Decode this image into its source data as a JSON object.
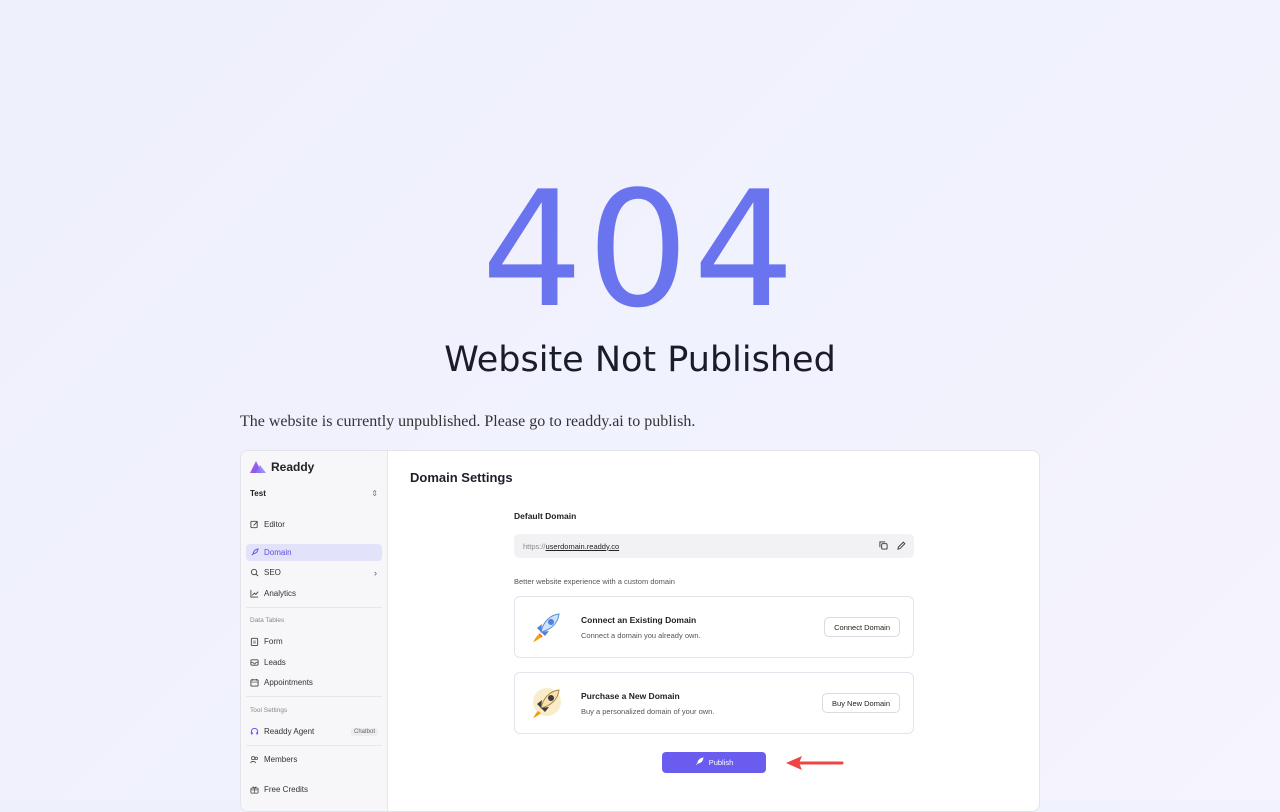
{
  "error": {
    "code": "404",
    "title": "Website Not Published",
    "message": "The website is currently unpublished. Please go to readdy.ai to publish."
  },
  "screenshot": {
    "logo_text": "Readdy",
    "project_name": "Test",
    "nav": {
      "editor": "Editor",
      "domain": "Domain",
      "seo": "SEO",
      "analytics": "Analytics",
      "data_tables_label": "Data Tables",
      "form": "Form",
      "leads": "Leads",
      "appointments": "Appointments",
      "tool_settings_label": "Tool Settings",
      "agent": "Readdy Agent",
      "agent_badge": "Chatbot",
      "members": "Members",
      "free_credits": "Free Credits"
    },
    "content": {
      "title": "Domain Settings",
      "default_domain_label": "Default Domain",
      "domain_prefix": "https://",
      "domain_value": "userdomain.readdy.co",
      "hint": "Better website experience with a custom domain",
      "cards": [
        {
          "title": "Connect an Existing Domain",
          "desc": "Connect a domain you already own.",
          "button": "Connect Domain",
          "icon": "rocket-icon"
        },
        {
          "title": "Purchase a New Domain",
          "desc": "Buy a personalized domain of your own.",
          "button": "Buy New Domain",
          "icon": "rocket-gold-icon"
        }
      ],
      "publish_button": "Publish"
    }
  },
  "colors": {
    "accent": "#6b74ef",
    "publish": "#6b5cf0",
    "arrow": "#ef4444",
    "active_nav_bg": "#e3e2fb"
  }
}
